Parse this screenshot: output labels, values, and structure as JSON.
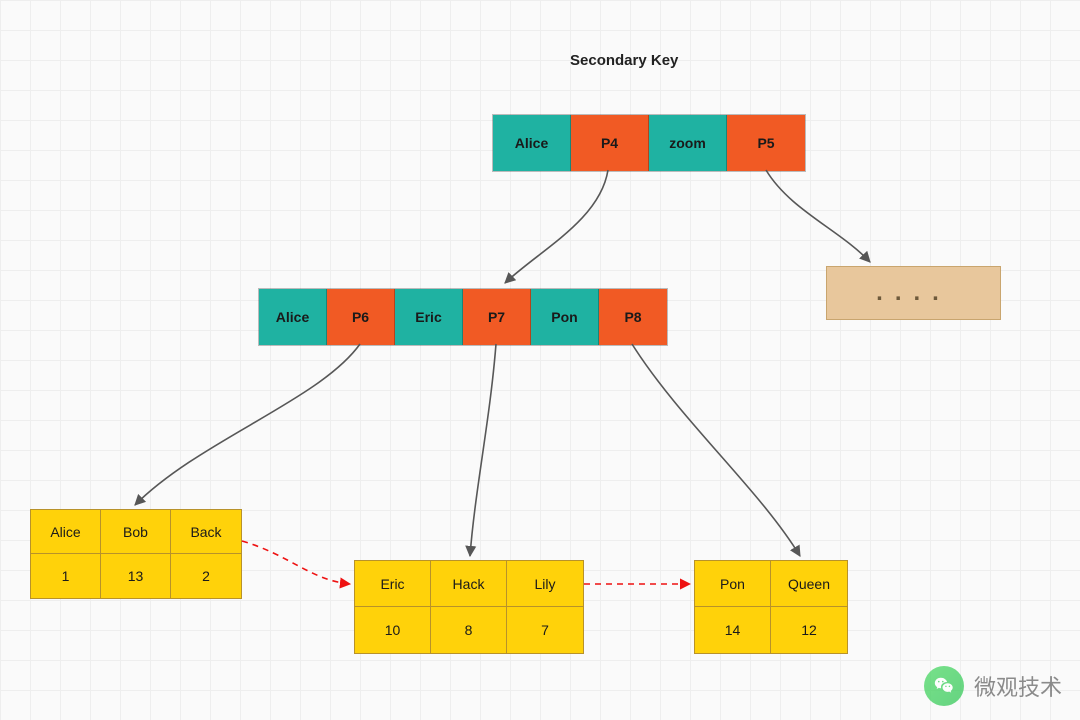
{
  "title": "Secondary Key",
  "colors": {
    "teal": "#1fb2a2",
    "orange": "#f15a24",
    "yellow": "#ffd20a",
    "tan": "#e8c79c"
  },
  "root": {
    "cells": [
      {
        "label": "Alice",
        "kind": "key"
      },
      {
        "label": "P4",
        "kind": "ptr"
      },
      {
        "label": "zoom",
        "kind": "key"
      },
      {
        "label": "P5",
        "kind": "ptr"
      }
    ]
  },
  "internal": {
    "cells": [
      {
        "label": "Alice",
        "kind": "key"
      },
      {
        "label": "P6",
        "kind": "ptr"
      },
      {
        "label": "Eric",
        "kind": "key"
      },
      {
        "label": "P7",
        "kind": "ptr"
      },
      {
        "label": "Pon",
        "kind": "key"
      },
      {
        "label": "P8",
        "kind": "ptr"
      }
    ]
  },
  "overflow_box": "....",
  "leaves": [
    {
      "id": "leaf1",
      "keys": [
        "Alice",
        "Bob",
        "Back"
      ],
      "vals": [
        "1",
        "13",
        "2"
      ]
    },
    {
      "id": "leaf2",
      "keys": [
        "Eric",
        "Hack",
        "Lily"
      ],
      "vals": [
        "10",
        "8",
        "7"
      ]
    },
    {
      "id": "leaf3",
      "keys": [
        "Pon",
        "Queen"
      ],
      "vals": [
        "14",
        "12"
      ]
    }
  ],
  "watermark": "微观技术"
}
